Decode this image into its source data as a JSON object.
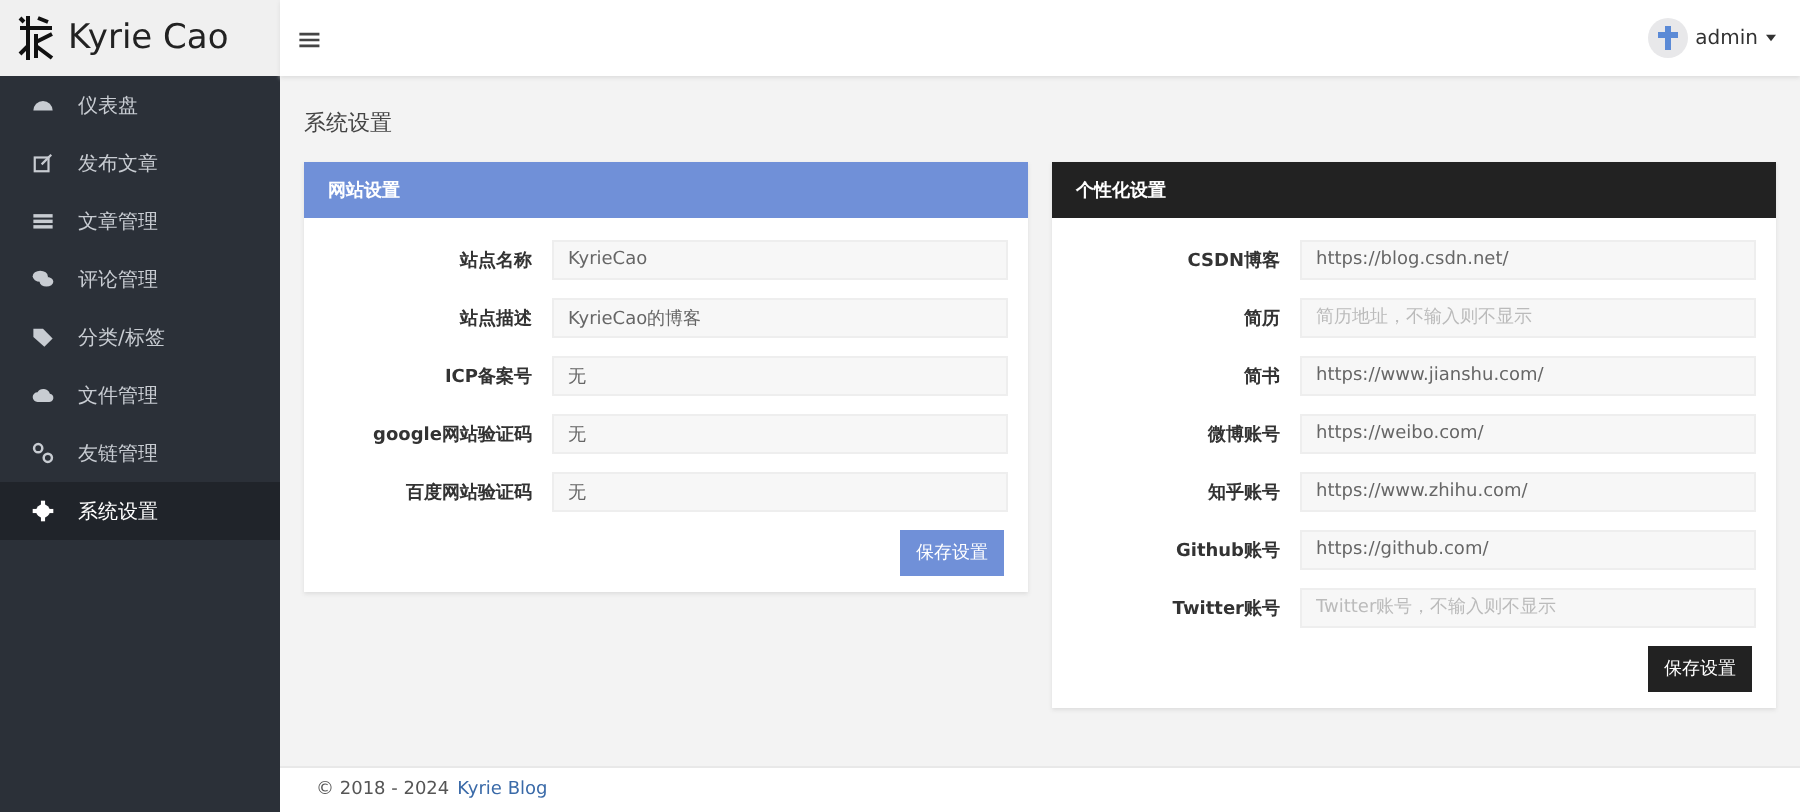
{
  "brand": {
    "name": "Kyrie Cao"
  },
  "topbar": {
    "menu_icon": "≡",
    "user": "admin"
  },
  "sidebar": {
    "items": [
      {
        "label": "仪表盘",
        "selected": false
      },
      {
        "label": "发布文章",
        "selected": false
      },
      {
        "label": "文章管理",
        "selected": false
      },
      {
        "label": "评论管理",
        "selected": false
      },
      {
        "label": "分类/标签",
        "selected": false
      },
      {
        "label": "文件管理",
        "selected": false
      },
      {
        "label": "友链管理",
        "selected": false
      },
      {
        "label": "系统设置",
        "selected": true
      }
    ]
  },
  "page_title": "系统设置",
  "panels": [
    {
      "title": "网站设置",
      "fields": [
        {
          "label": "站点名称",
          "value": "KyrieCao"
        },
        {
          "label": "站点描述",
          "value": "KyrieCao的博客"
        },
        {
          "label": "ICP备案号",
          "value": "无"
        },
        {
          "label": "google网站验证码",
          "value": "无"
        },
        {
          "label": "百度网站验证码",
          "value": "无"
        }
      ],
      "button": "保存设置"
    },
    {
      "title": "个性化设置",
      "fields": [
        {
          "label": "CSDN博客",
          "value": "https://blog.csdn.net/"
        },
        {
          "label": "简历",
          "placeholder": "简历地址，不输入则不显示"
        },
        {
          "label": "简书",
          "value": "https://www.jianshu.com/"
        },
        {
          "label": "微博账号",
          "value": "https://weibo.com/"
        },
        {
          "label": "知乎账号",
          "value": "https://www.zhihu.com/"
        },
        {
          "label": "Github账号",
          "value": "https://github.com/"
        },
        {
          "label": "Twitter账号",
          "placeholder": "Twitter账号，不输入则不显示"
        }
      ],
      "button": "保存设置"
    }
  ],
  "footer": {
    "text": "© 2018 - 2024",
    "link": "Kyrie Blog"
  }
}
